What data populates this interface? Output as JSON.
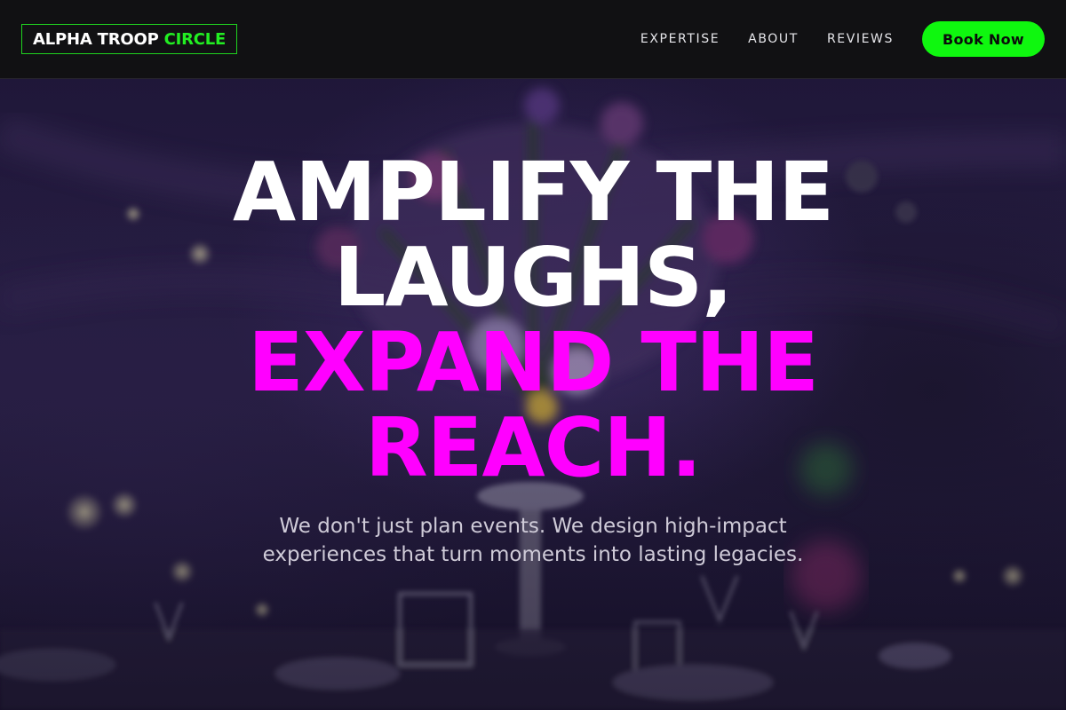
{
  "brand": {
    "name_primary": "ALPHA TROOP",
    "name_accent": "CIRCLE",
    "accent_color": "#22ee22"
  },
  "nav": {
    "links": [
      {
        "label": "EXPERTISE"
      },
      {
        "label": "ABOUT"
      },
      {
        "label": "REVIEWS"
      }
    ],
    "cta_label": "Book Now",
    "cta_color": "#0ff70f"
  },
  "hero": {
    "headline_lines": [
      {
        "text": "AMPLIFY THE",
        "color": "white"
      },
      {
        "text": "LAUGHS,",
        "color": "white"
      },
      {
        "text": "EXPAND THE",
        "color": "pink"
      },
      {
        "text": "REACH.",
        "color": "pink"
      }
    ],
    "headline_accent_color": "#ff00ff",
    "subtext_lines": [
      "We don't just plan events. We design high-impact",
      "experiences that turn moments into lasting legacies."
    ],
    "background_image": "dim purple banquet table setting with floral centerpiece"
  }
}
